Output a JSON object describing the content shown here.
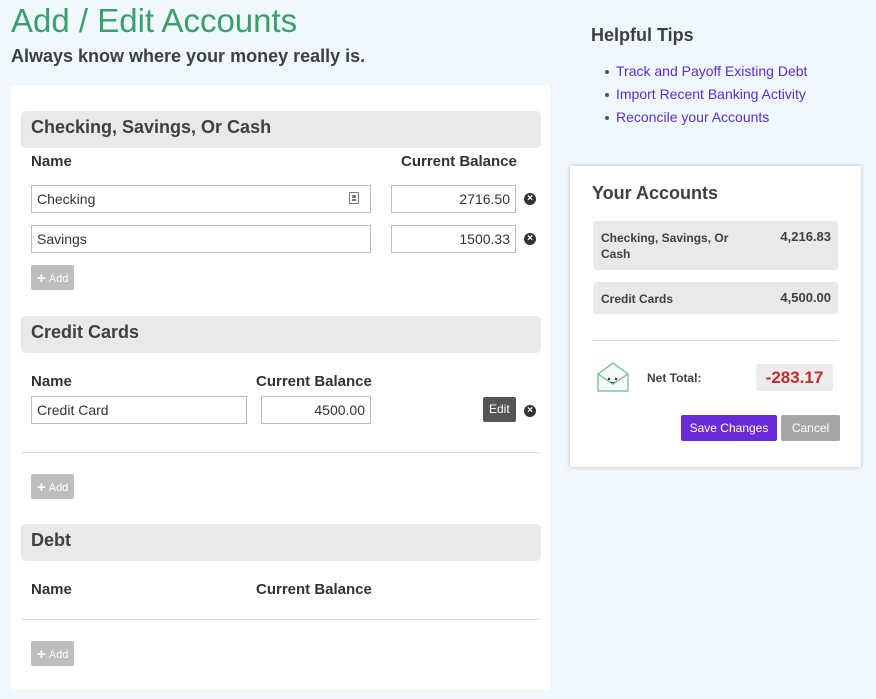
{
  "header": {
    "title": "Add / Edit Accounts",
    "tagline": "Always know where your money really is."
  },
  "sections": {
    "cash": {
      "title": "Checking, Savings, Or Cash",
      "col_name": "Name",
      "col_balance": "Current Balance",
      "rows": [
        {
          "name": "Checking",
          "balance": "2716.50"
        },
        {
          "name": "Savings",
          "balance": "1500.33"
        }
      ],
      "add_label": "Add"
    },
    "credit": {
      "title": "Credit Cards",
      "col_name": "Name",
      "col_balance": "Current Balance",
      "rows": [
        {
          "name": "Credit Card",
          "balance": "4500.00",
          "edit_label": "Edit"
        }
      ],
      "add_label": "Add"
    },
    "debt": {
      "title": "Debt",
      "col_name": "Name",
      "col_balance": "Current Balance",
      "add_label": "Add"
    }
  },
  "tips": {
    "title": "Helpful Tips",
    "links": [
      "Track and Payoff Existing Debt",
      "Import Recent Banking Activity",
      "Reconcile your Accounts"
    ]
  },
  "summary": {
    "title": "Your Accounts",
    "rows": [
      {
        "label": "Checking, Savings, Or Cash",
        "value": "4,216.83"
      },
      {
        "label": "Credit Cards",
        "value": "4,500.00"
      }
    ],
    "net_label": "Net Total:",
    "net_value": "-283.17",
    "save_label": "Save Changes",
    "cancel_label": "Cancel"
  },
  "icons": {
    "remove": "circle-x-icon",
    "add": "plus-icon",
    "contact": "contact-card-icon",
    "envelope": "envelope-mascot-icon"
  },
  "colors": {
    "title_green": "#3d9e6c",
    "link_purple": "#5b2bd6",
    "primary_button": "#6a2ad8",
    "net_negative": "#c52a2a",
    "background": "#eef8fd"
  }
}
